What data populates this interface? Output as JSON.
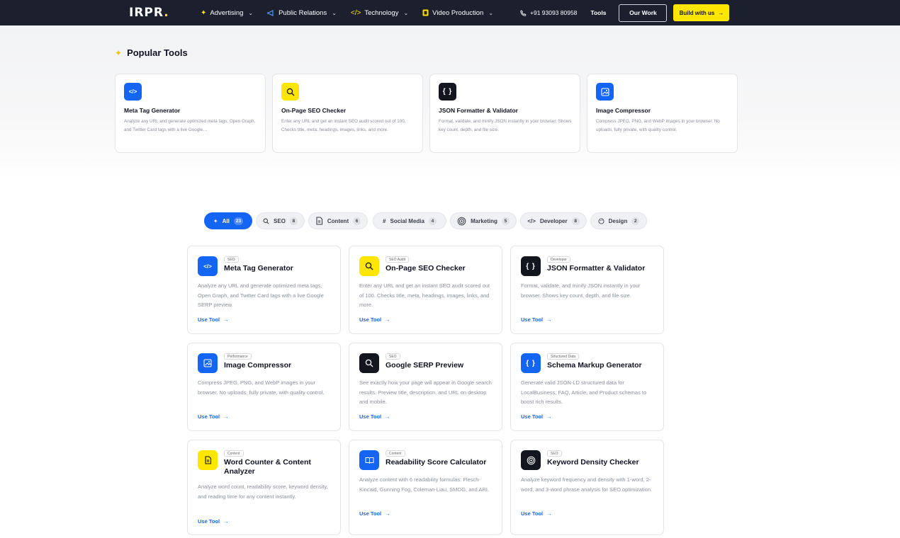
{
  "nav": {
    "logo": "IRPR",
    "logo_dot": ".",
    "items": [
      {
        "label": "Advertising",
        "icon": "sparkle-icon"
      },
      {
        "label": "Public Relations",
        "icon": "megaphone-icon"
      },
      {
        "label": "Technology",
        "icon": "code-icon"
      },
      {
        "label": "Video Production",
        "icon": "film-icon"
      }
    ],
    "phone": "+91 93093 80958",
    "tools": "Tools",
    "our_work": "Our Work",
    "build": "Build with us"
  },
  "popular": {
    "title": "Popular Tools",
    "cards": [
      {
        "title": "Meta Tag Generator",
        "desc": "Analyze any URL and generate optimized meta tags, Open Graph, and Twitter Card tags with a live Google…",
        "icon": "code-icon",
        "color": "blue"
      },
      {
        "title": "On-Page SEO Checker",
        "desc": "Enter any URL and get an instant SEO audit scored out of 100. Checks title, meta, headings, images, links, and more.",
        "icon": "search-icon",
        "color": "yellow"
      },
      {
        "title": "JSON Formatter & Validator",
        "desc": "Format, validate, and minify JSON instantly in your browser. Shows key count, depth, and file size.",
        "icon": "braces-icon",
        "color": "black"
      },
      {
        "title": "Image Compressor",
        "desc": "Compress JPEG, PNG, and WebP images in your browser. No uploads, fully private, with quality control.",
        "icon": "image-icon",
        "color": "blue"
      }
    ]
  },
  "filters": [
    {
      "label": "All",
      "count": "23"
    },
    {
      "label": "SEO",
      "count": "8"
    },
    {
      "label": "Content",
      "count": "6"
    },
    {
      "label": "Social Media",
      "count": "4"
    },
    {
      "label": "Marketing",
      "count": "5"
    },
    {
      "label": "Developer",
      "count": "8"
    },
    {
      "label": "Design",
      "count": "2"
    }
  ],
  "use_tool_label": "Use Tool",
  "tools": [
    {
      "tag": "SEO",
      "title": "Meta Tag Generator",
      "desc": "Analyze any URL and generate optimized meta tags, Open Graph, and Twitter Card tags with a live Google SERP preview.",
      "icon": "code-icon",
      "color": "blue"
    },
    {
      "tag": "SEO Audit",
      "title": "On-Page SEO Checker",
      "desc": "Enter any URL and get an instant SEO audit scored out of 100. Checks title, meta, headings, images, links, and more.",
      "icon": "search-icon",
      "color": "yellow"
    },
    {
      "tag": "Developer",
      "title": "JSON Formatter & Validator",
      "desc": "Format, validate, and minify JSON instantly in your browser. Shows key count, depth, and file size.",
      "icon": "braces-icon",
      "color": "black"
    },
    {
      "tag": "Performance",
      "title": "Image Compressor",
      "desc": "Compress JPEG, PNG, and WebP images in your browser. No uploads, fully private, with quality control.",
      "icon": "image-icon",
      "color": "blue"
    },
    {
      "tag": "SEO",
      "title": "Google SERP Preview",
      "desc": "See exactly how your page will appear in Google search results. Preview title, description, and URL on desktop and mobile.",
      "icon": "search-icon",
      "color": "black"
    },
    {
      "tag": "Structured Data",
      "title": "Schema Markup Generator",
      "desc": "Generate valid JSON-LD structured data for LocalBusiness, FAQ, Article, and Product schemas to boost rich results.",
      "icon": "braces-icon",
      "color": "blue"
    },
    {
      "tag": "Content",
      "title": "Word Counter & Content Analyzer",
      "desc": "Analyze word count, readability score, keyword density, and reading time for any content instantly.",
      "icon": "document-icon",
      "color": "yellow"
    },
    {
      "tag": "Content",
      "title": "Readability Score Calculator",
      "desc": "Analyze content with 6 readability formulas: Flesch-Kincaid, Gunning Fog, Coleman-Liau, SMOG, and ARI.",
      "icon": "book-icon",
      "color": "blue"
    },
    {
      "tag": "SEO",
      "title": "Keyword Density Checker",
      "desc": "Analyze keyword frequency and density with 1-word, 2-word, and 3-word phrase analysis for SEO optimization.",
      "icon": "target-icon",
      "color": "black"
    }
  ]
}
